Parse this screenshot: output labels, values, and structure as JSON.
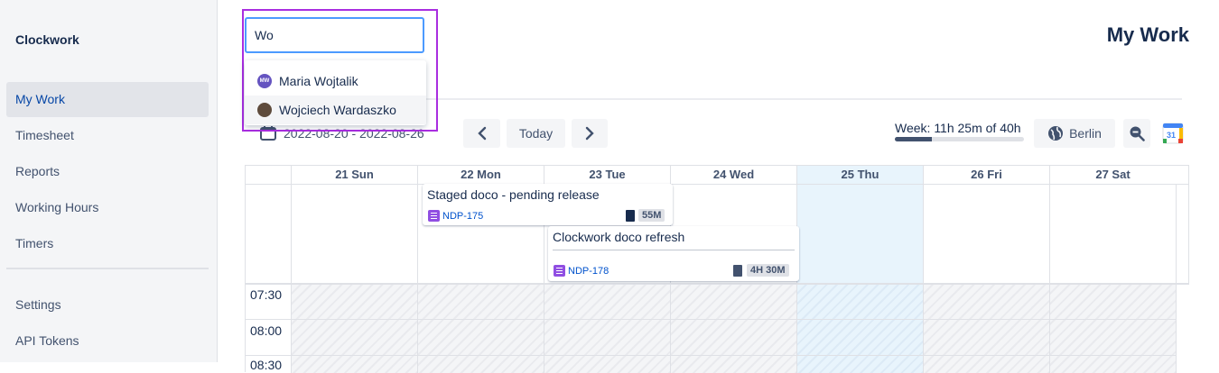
{
  "app": {
    "name": "Clockwork",
    "page_title": "My Work"
  },
  "sidebar": {
    "items": [
      {
        "label": "My Work",
        "active": true
      },
      {
        "label": "Timesheet"
      },
      {
        "label": "Reports"
      },
      {
        "label": "Working Hours"
      },
      {
        "label": "Timers"
      },
      {
        "label": "Settings"
      },
      {
        "label": "API Tokens"
      }
    ]
  },
  "search": {
    "value": "Wo",
    "results": [
      {
        "name": "Maria Wojtalik",
        "initials": "MW",
        "avatar_color": "#6554c0"
      },
      {
        "name": "Wojciech Wardaszko",
        "initials": "",
        "avatar_color": "#5e4b3c",
        "highlighted": true
      }
    ]
  },
  "toolbar": {
    "date_range": "2022-08-20 - 2022-08-26",
    "today_label": "Today",
    "week_summary": "Week: 11h 25m of 40h",
    "week_progress": 0.286,
    "timezone": "Berlin",
    "calendar_icon_text": "31"
  },
  "calendar": {
    "days": [
      "21 Sun",
      "22 Mon",
      "23 Tue",
      "24 Wed",
      "25 Thu",
      "26 Fri",
      "27 Sat"
    ],
    "today_index": 4,
    "hours": [
      "07:30",
      "08:00",
      "08:30"
    ]
  },
  "events": [
    {
      "title": "Staged doco - pending release",
      "issue": "NDP-175",
      "duration": "55M"
    },
    {
      "title": "Clockwork doco refresh",
      "issue": "NDP-178",
      "duration": "4H 30M"
    }
  ],
  "colors": {
    "accent": "#0052cc",
    "today": "#e8f4fc",
    "highlight_border": "#a92ee0",
    "issue_icon": "#904ee2"
  }
}
